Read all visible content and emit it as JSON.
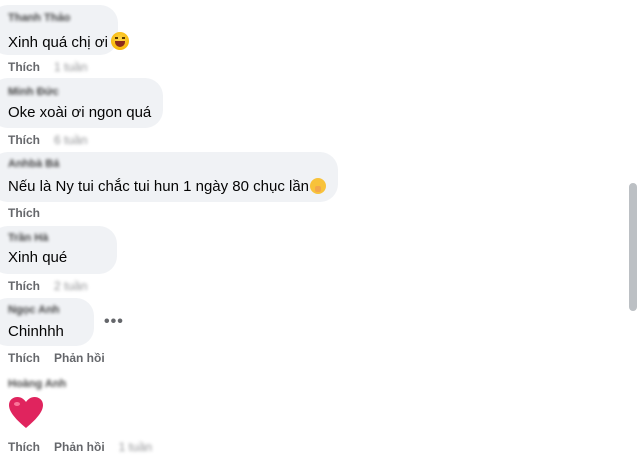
{
  "comments": [
    {
      "author": "Thanh Thảo",
      "text": "Xinh quá chị ơi",
      "emoji": "laughing-face",
      "actions": [
        "Thích"
      ],
      "time": "1 tuần"
    },
    {
      "author": "Minh Đức",
      "text": "Oke xoài ơi ngon quá",
      "actions": [
        "Thích"
      ],
      "time": "6 tuần"
    },
    {
      "author": "Anhbà Bá",
      "text": "Nếu là Ny tui chắc tui hun 1 ngày 80 chục lần",
      "emoji": "shushing-face",
      "actions": [
        "Thích"
      ]
    },
    {
      "author": "Trần Hà",
      "text": "Xinh qué",
      "actions": [
        "Thích"
      ],
      "time": "2 tuần"
    },
    {
      "author": "Ngọc Anh",
      "text": "Chinhhh",
      "actions": [
        "Thích",
        "Phản hồi"
      ]
    },
    {
      "author": "Hoàng Anh",
      "emoji": "red-heart",
      "actions": [
        "Thích",
        "Phản hồi"
      ],
      "time": "1 tuần"
    }
  ],
  "more_options": "•••",
  "colors": {
    "bubble": "#f0f2f5",
    "action_text": "#65676b",
    "scrollbar": "#bcc0c4",
    "heart": "#e0245e"
  }
}
